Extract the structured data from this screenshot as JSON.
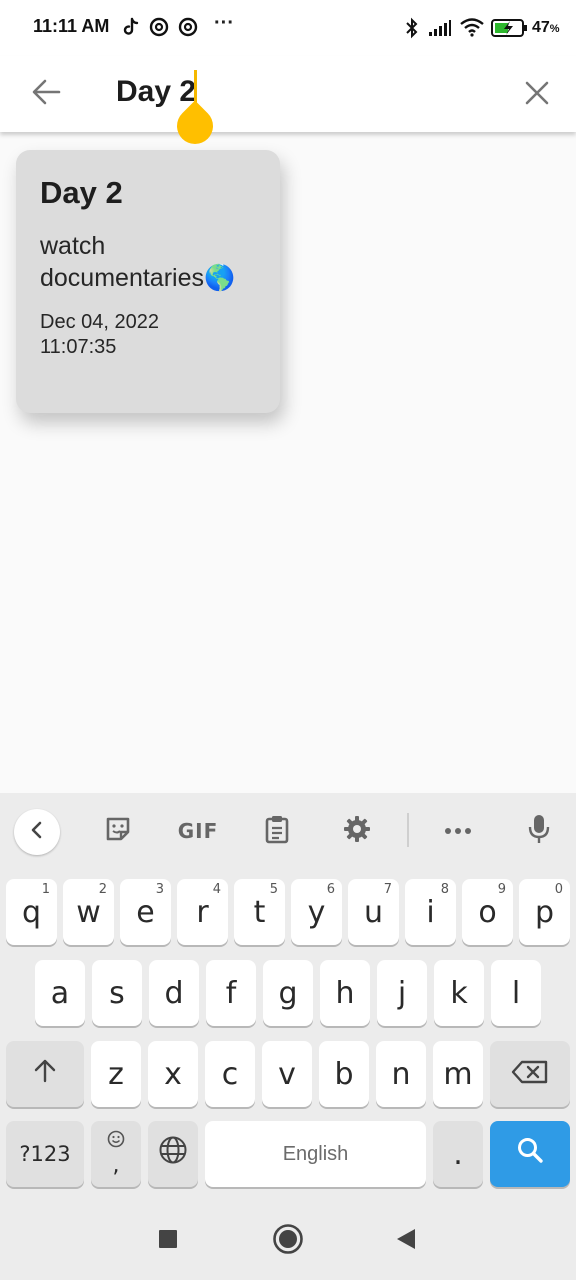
{
  "status_bar": {
    "time": "11:11 AM",
    "more_label": "···",
    "battery_percent": "47",
    "battery_unit": "%",
    "icons": [
      "tiktok-icon",
      "threads-icon",
      "threads-icon",
      "bluetooth-icon",
      "signal-icon",
      "wifi-icon",
      "battery-charging-icon"
    ]
  },
  "search": {
    "query": "Day 2",
    "back_icon": "arrow-left-icon",
    "clear_icon": "close-icon",
    "cursor_color": "#ffbf00"
  },
  "results": [
    {
      "title": "Day 2",
      "body": "watch documentaries🌎",
      "date": "Dec 04, 2022",
      "time": "11:07:35"
    }
  ],
  "keyboard": {
    "toolbar": [
      "chevron-left-icon",
      "sticker-icon",
      "GIF",
      "clipboard-icon",
      "gear-icon",
      "more-icon",
      "microphone-icon"
    ],
    "row1": [
      {
        "label": "q",
        "hint": "1"
      },
      {
        "label": "w",
        "hint": "2"
      },
      {
        "label": "e",
        "hint": "3"
      },
      {
        "label": "r",
        "hint": "4"
      },
      {
        "label": "t",
        "hint": "5"
      },
      {
        "label": "y",
        "hint": "6"
      },
      {
        "label": "u",
        "hint": "7"
      },
      {
        "label": "i",
        "hint": "8"
      },
      {
        "label": "o",
        "hint": "9"
      },
      {
        "label": "p",
        "hint": "0"
      }
    ],
    "row2": [
      "a",
      "s",
      "d",
      "f",
      "g",
      "h",
      "j",
      "k",
      "l"
    ],
    "row3": [
      "z",
      "x",
      "c",
      "v",
      "b",
      "n",
      "m"
    ],
    "symbols_label": "?123",
    "emoji_comma": ",",
    "space_label": "English",
    "period_label": ".",
    "accent_color": "#2f9be6"
  },
  "nav_bar": {
    "icons": [
      "square-recents-icon",
      "circle-home-icon",
      "triangle-back-icon"
    ]
  }
}
